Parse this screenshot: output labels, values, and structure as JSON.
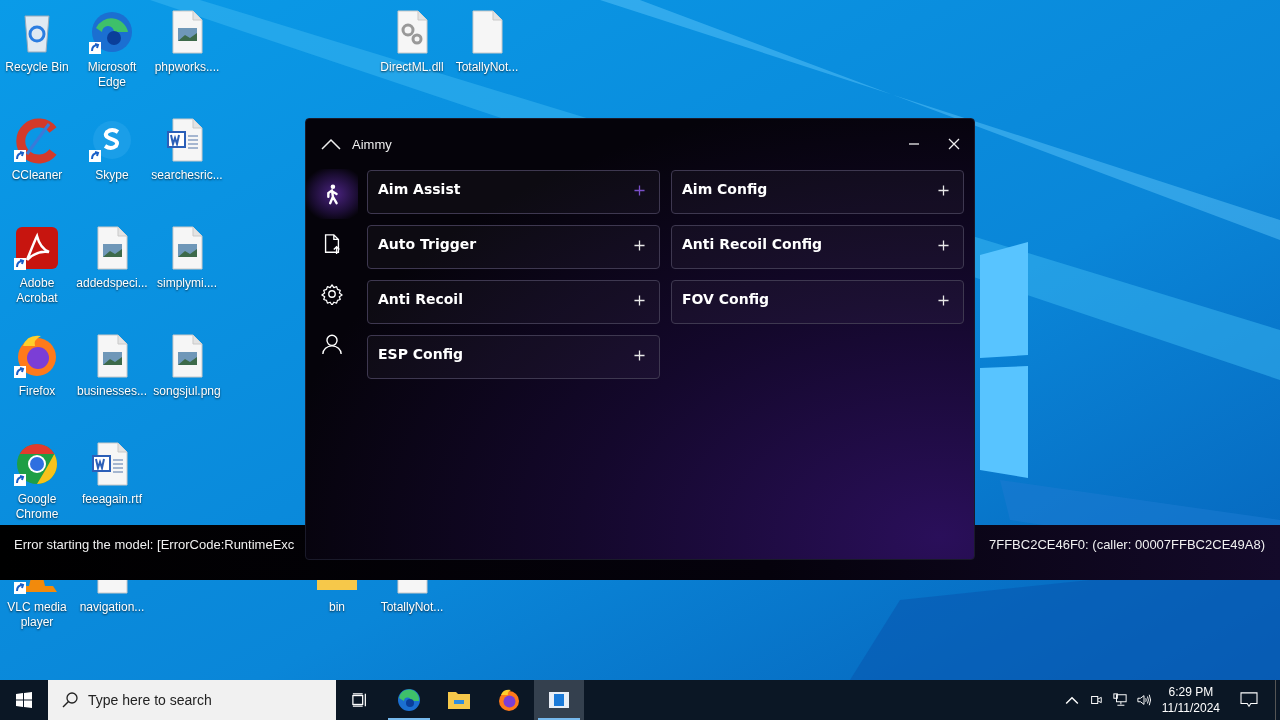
{
  "desktop": {
    "icons": [
      {
        "label": "Recycle Bin",
        "kind": "recycle",
        "shortcut": false
      },
      {
        "label": "Microsoft Edge",
        "kind": "edge",
        "shortcut": true
      },
      {
        "label": "phpworks....",
        "kind": "image-file",
        "shortcut": false
      },
      {
        "label": "DirectML.dll",
        "kind": "dll",
        "shortcut": false
      },
      {
        "label": "TotallyNot...",
        "kind": "blank-file",
        "shortcut": false
      },
      {
        "label": "CCleaner",
        "kind": "ccleaner",
        "shortcut": true
      },
      {
        "label": "Skype",
        "kind": "skype",
        "shortcut": true
      },
      {
        "label": "searchesric...",
        "kind": "word",
        "shortcut": false
      },
      {
        "label": "Adobe Acrobat",
        "kind": "acrobat",
        "shortcut": true
      },
      {
        "label": "addedspeci...",
        "kind": "image-file",
        "shortcut": false
      },
      {
        "label": "simplymi....",
        "kind": "image-file",
        "shortcut": false
      },
      {
        "label": "Firefox",
        "kind": "firefox",
        "shortcut": true
      },
      {
        "label": "businesses...",
        "kind": "image-file",
        "shortcut": false
      },
      {
        "label": "songsjul.png",
        "kind": "image-file",
        "shortcut": false
      },
      {
        "label": "Google Chrome",
        "kind": "chrome",
        "shortcut": true
      },
      {
        "label": "feeagain.rtf",
        "kind": "word",
        "shortcut": false
      },
      {
        "label": "VLC media player",
        "kind": "vlc",
        "shortcut": true
      },
      {
        "label": "navigation...",
        "kind": "blank-file",
        "shortcut": false
      },
      {
        "label": "bin",
        "kind": "folder",
        "shortcut": false
      },
      {
        "label": "TotallyNot...",
        "kind": "blank-file",
        "shortcut": false
      }
    ]
  },
  "error_bar": {
    "left_text": "Error starting the model: [ErrorCode:RuntimeExc",
    "right_text": "7FFBC2CE46F0: (caller: 00007FFBC2CE49A8)"
  },
  "window": {
    "title": "Aimmy",
    "sidebar": [
      {
        "kind": "aim",
        "selected": true
      },
      {
        "kind": "file",
        "selected": false
      },
      {
        "kind": "settings",
        "selected": false
      },
      {
        "kind": "user",
        "selected": false
      }
    ],
    "cards": [
      {
        "label": "Aim Assist",
        "hovered": true
      },
      {
        "label": "Aim Config",
        "hovered": false
      },
      {
        "label": "Auto Trigger",
        "hovered": false
      },
      {
        "label": "Anti Recoil Config",
        "hovered": false
      },
      {
        "label": "Anti Recoil",
        "hovered": false
      },
      {
        "label": "FOV Config",
        "hovered": false
      },
      {
        "label": "ESP Config",
        "hovered": false
      }
    ]
  },
  "taskbar": {
    "search": {
      "placeholder": "Type here to search"
    },
    "apps": [
      {
        "kind": "edge",
        "running": true,
        "selected": false
      },
      {
        "kind": "explorer",
        "running": false,
        "selected": false
      },
      {
        "kind": "firefox",
        "running": false,
        "selected": false
      },
      {
        "kind": "aimmy",
        "running": true,
        "selected": true
      }
    ],
    "clock": {
      "time": "6:29 PM",
      "date": "11/11/2024"
    }
  }
}
